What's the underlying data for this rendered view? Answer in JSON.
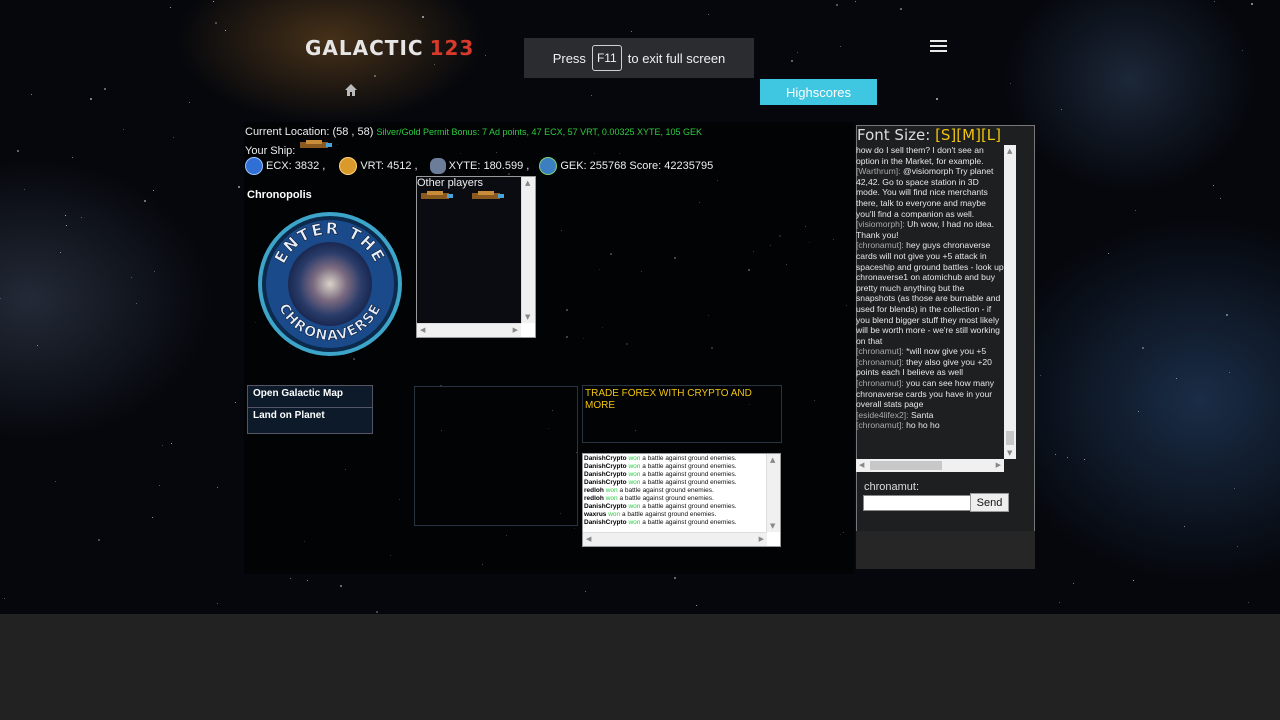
{
  "header": {
    "logo_text": "GALACTIC",
    "logo_number": "123",
    "fullscreen_prefix": "Press",
    "fullscreen_key": "F11",
    "fullscreen_suffix": "to exit full screen",
    "highscores_label": "Highscores",
    "home_icon": "home-icon",
    "menu_icon": "hamburger-menu-icon"
  },
  "status": {
    "location_label": "Current Location:",
    "location_coords": "(58 , 58)",
    "bonus_text": "Silver/Gold Permit Bonus: 7 Ad points, 47 ECX, 57 VRT, 0.00325 XYTE, 105 GEK",
    "ship_label": "Your Ship:",
    "resources": [
      {
        "label": "ECX: 3832 ,",
        "icon": "ecx-icon"
      },
      {
        "label": "VRT: 4512 ,",
        "icon": "vrt-icon"
      },
      {
        "label": "XYTE: 180.599 ,",
        "icon": "xyte-icon"
      },
      {
        "label": "GEK: 255768 Score: 42235795",
        "icon": "gek-icon"
      }
    ]
  },
  "planet": {
    "name": "Chronopolis",
    "badge_text_top": "ENTER THE",
    "badge_text_bottom": "CHRONAVERSE"
  },
  "other_players": {
    "label": "Other players"
  },
  "actions": {
    "open_map": "Open Galactic Map",
    "land": "Land on Planet"
  },
  "ad": {
    "text": "TRADE FOREX WITH CRYPTO AND MORE"
  },
  "battle_log": [
    {
      "player": "DanishCrypto",
      "verb": "won",
      "rest": "a battle against ground enemies."
    },
    {
      "player": "DanishCrypto",
      "verb": "won",
      "rest": "a battle against ground enemies."
    },
    {
      "player": "DanishCrypto",
      "verb": "won",
      "rest": "a battle against ground enemies."
    },
    {
      "player": "DanishCrypto",
      "verb": "won",
      "rest": "a battle against ground enemies."
    },
    {
      "player": "redloh",
      "verb": "won",
      "rest": "a battle against ground enemies."
    },
    {
      "player": "redloh",
      "verb": "won",
      "rest": "a battle against ground enemies."
    },
    {
      "player": "DanishCrypto",
      "verb": "won",
      "rest": "a battle against ground enemies."
    },
    {
      "player": "waxrus",
      "verb": "won",
      "rest": "a battle against ground enemies."
    },
    {
      "player": "DanishCrypto",
      "verb": "won",
      "rest": "a battle against ground enemies."
    }
  ],
  "chat": {
    "font_size_label": "Font Size:",
    "font_options": [
      "[S]",
      "[M]",
      "[L]"
    ],
    "messages": [
      {
        "user": "",
        "text": "how do I sell them? I don't see an option in the Market, for example."
      },
      {
        "user": "[Warthrum]:",
        "text": "@visiomorph Try planet 42,42. Go to space station in 3D mode. You will find nice merchants there, talk to everyone and maybe you'll find a companion as well."
      },
      {
        "user": "[visiomorph]:",
        "text": "Uh wow, I had no idea. Thank you!"
      },
      {
        "user": "[chronamut]:",
        "text": "hey guys chronaverse cards will not give you +5 attack in spaceship and ground battles - look up chronaverse1 on atomichub and buy pretty much anything but the snapshots (as those are burnable and used for blends) in the collection - if you blend bigger stuff they most likely will be worth more - we're still working on that"
      },
      {
        "user": "[chronamut]:",
        "text": "*will now give you +5"
      },
      {
        "user": "[chronamut]:",
        "text": "they also give you +20 points each I believe as well"
      },
      {
        "user": "[chronamut]:",
        "text": "you can see how many chronaverse cards you have in your overall stats page"
      },
      {
        "user": "[eside4lifex2]:",
        "text": "Santa"
      },
      {
        "user": "[chronamut]:",
        "text": "ho ho ho"
      }
    ],
    "username_label": "chronamut:",
    "input_value": "",
    "send_label": "Send"
  }
}
